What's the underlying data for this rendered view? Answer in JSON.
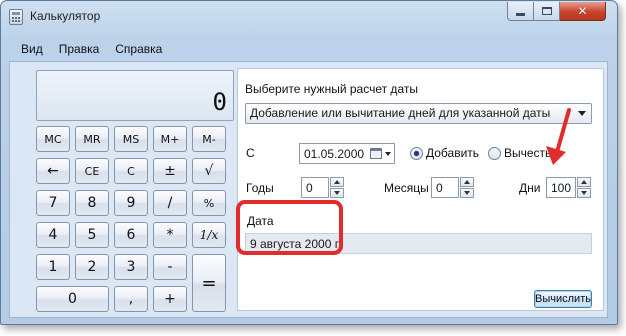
{
  "window": {
    "title": "Калькулятор",
    "close_glyph": "✕"
  },
  "menu": {
    "items": [
      "Вид",
      "Правка",
      "Справка"
    ]
  },
  "display": {
    "value": "0"
  },
  "keypad": {
    "memory_row": [
      "MC",
      "MR",
      "MS",
      "M+",
      "M-"
    ],
    "row2": [
      "←",
      "CE",
      "C",
      "±",
      "√"
    ],
    "row3": [
      "7",
      "8",
      "9",
      "/",
      "%"
    ],
    "row4": [
      "4",
      "5",
      "6",
      "*",
      "1/x"
    ],
    "row5": [
      "1",
      "2",
      "3",
      "-"
    ],
    "row6": [
      "0",
      ",",
      "+"
    ],
    "equals": "="
  },
  "date_panel": {
    "header": "Выберите нужный расчет даты",
    "mode_selected": "Добавление или вычитание дней для указанной даты",
    "from_label": "С",
    "from_date": "01.05.2000",
    "add_label": "Добавить",
    "subtract_label": "Вычесть",
    "add_selected": true,
    "years_label": "Годы",
    "years_value": "0",
    "months_label": "Месяцы",
    "months_value": "0",
    "days_label": "Дни",
    "days_value": "100",
    "result_label": "Дата",
    "result_value": "9 августа 2000 г.",
    "compute_button": "Вычислить"
  },
  "colors": {
    "annotation": "#e22b2b",
    "radio_fill": "#1f3f7a"
  }
}
